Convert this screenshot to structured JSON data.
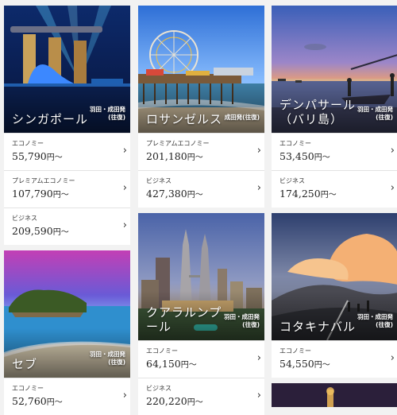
{
  "cards": [
    {
      "destination": "シンガポール",
      "airport": "羽田・成田発(往復)",
      "fares": [
        {
          "class": "エコノミー",
          "price": "55,790",
          "unit": "円〜"
        },
        {
          "class": "プレミアムエコノミー",
          "price": "107,790",
          "unit": "円〜"
        },
        {
          "class": "ビジネス",
          "price": "209,590",
          "unit": "円〜"
        }
      ]
    },
    {
      "destination": "ロサンゼルス",
      "airport": "成田発(往復)",
      "fares": [
        {
          "class": "プレミアムエコノミー",
          "price": "201,180",
          "unit": "円〜"
        },
        {
          "class": "ビジネス",
          "price": "427,380",
          "unit": "円〜"
        }
      ]
    },
    {
      "destination": "デンパサール（バリ島）",
      "airport": "羽田・成田発(往復)",
      "fares": [
        {
          "class": "エコノミー",
          "price": "53,450",
          "unit": "円〜"
        },
        {
          "class": "ビジネス",
          "price": "174,250",
          "unit": "円〜"
        }
      ]
    },
    {
      "destination": "セブ",
      "airport": "羽田・成田発(往復)",
      "fares": [
        {
          "class": "エコノミー",
          "price": "52,760",
          "unit": "円〜"
        }
      ]
    },
    {
      "destination": "クアラルンプール",
      "airport": "羽田・成田発(往復)",
      "fares": [
        {
          "class": "エコノミー",
          "price": "64,150",
          "unit": "円〜"
        },
        {
          "class": "ビジネス",
          "price": "220,220",
          "unit": "円〜"
        }
      ]
    },
    {
      "destination": "コタキナバル",
      "airport": "羽田・成田発(往復)",
      "fares": [
        {
          "class": "エコノミー",
          "price": "54,550",
          "unit": "円〜"
        }
      ]
    }
  ],
  "icons": {
    "fare_arrow": "chevron-right-icon"
  }
}
